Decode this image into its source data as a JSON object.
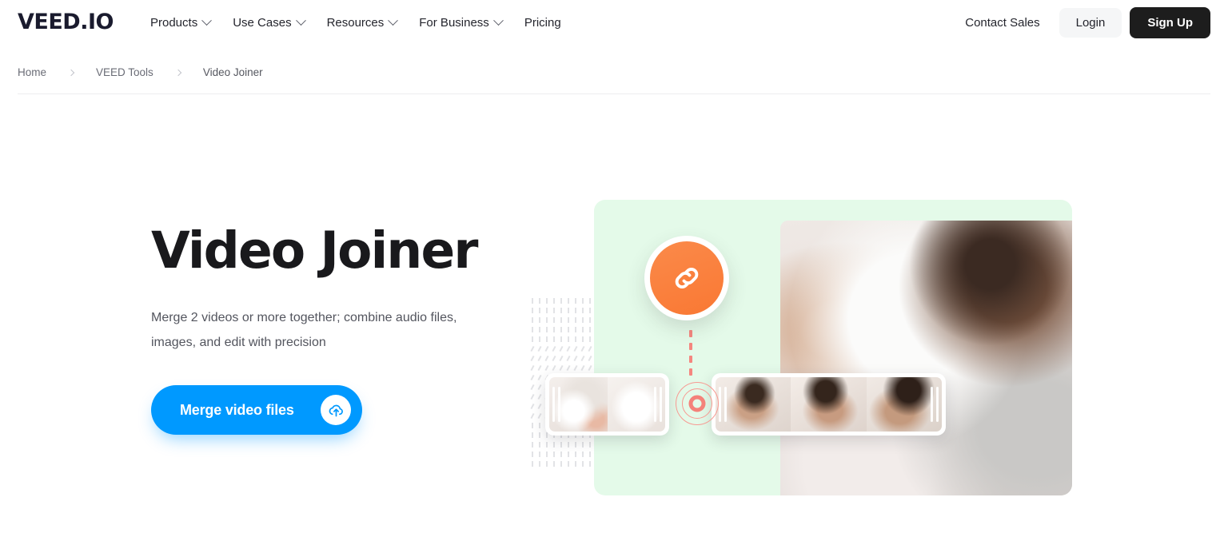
{
  "brand": {
    "logo_text": "VEED.IO",
    "accent_blue": "#0099FF",
    "accent_orange": "#F97833",
    "accent_coral": "#F5867F",
    "panel_green": "#E4FAE9",
    "dark": "#1D1D1D"
  },
  "header": {
    "nav_items": [
      {
        "label": "Products",
        "has_dropdown": true,
        "icon": "chevron-down-icon"
      },
      {
        "label": "Use Cases",
        "has_dropdown": true,
        "icon": "chevron-down-icon"
      },
      {
        "label": "Resources",
        "has_dropdown": true,
        "icon": "chevron-down-icon"
      },
      {
        "label": "For Business",
        "has_dropdown": true,
        "icon": "chevron-down-icon"
      },
      {
        "label": "Pricing",
        "has_dropdown": false,
        "icon": ""
      }
    ],
    "contact_sales_label": "Contact Sales",
    "login_label": "Login",
    "signup_label": "Sign Up"
  },
  "breadcrumb": {
    "items": [
      {
        "label": "Home",
        "current": false
      },
      {
        "label": "VEED Tools",
        "current": false
      },
      {
        "label": "Video Joiner",
        "current": true
      }
    ],
    "separator_icon": "chevron-right-icon"
  },
  "hero": {
    "title": "Video Joiner",
    "subtitle": "Merge 2 videos or more together; combine audio files, images, and edit with precision",
    "cta": {
      "label": "Merge video files",
      "icon": "cloud-upload-icon"
    }
  },
  "illustration": {
    "link_badge_icon": "link-icon",
    "target_icon": "record-target-icon",
    "connector_icon": "dashed-line-icon",
    "dot_grid_icon": "dot-grid-pattern",
    "main_photo_alt": "baker decorating a cake",
    "clips": [
      {
        "name": "clip-cake",
        "frames": [
          "cake-decorating-frame",
          "cake-stand-frame"
        ],
        "handles": [
          "trim-handle-left",
          "trim-handle-right"
        ]
      },
      {
        "name": "clip-faces",
        "frames": [
          "smiling-man-frame-1",
          "smiling-man-frame-2",
          "smiling-man-frame-3"
        ],
        "handles": [
          "trim-handle-left",
          "trim-handle-right"
        ]
      }
    ]
  }
}
